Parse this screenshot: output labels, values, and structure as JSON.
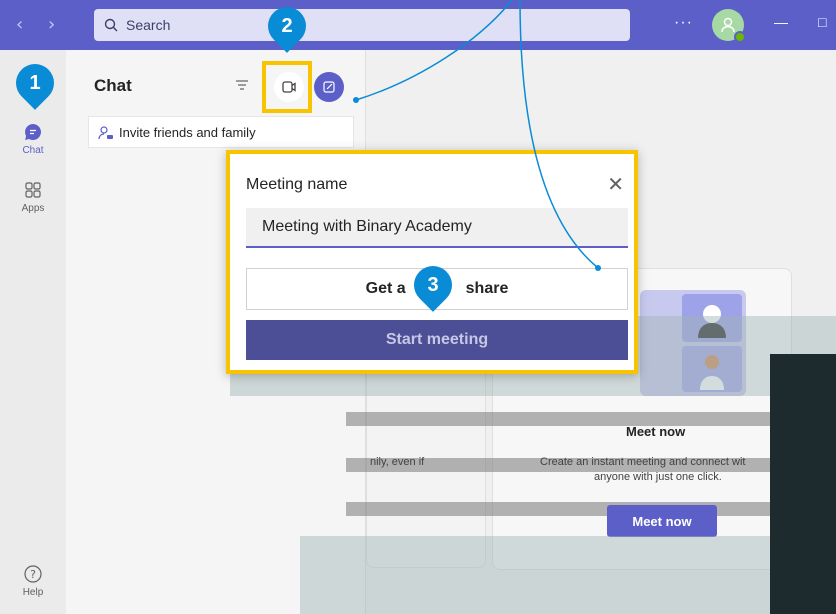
{
  "titlebar": {
    "search_placeholder": "Search",
    "more_label": "···",
    "minimize_label": "—",
    "maximize_label": "□"
  },
  "rail": {
    "items": [
      {
        "label": "Chat",
        "icon": "chat-icon"
      },
      {
        "label": "Apps",
        "icon": "apps-icon"
      },
      {
        "label": "Help",
        "icon": "help-icon"
      }
    ]
  },
  "chat_list": {
    "title": "Chat",
    "invite_label": "Invite friends and family"
  },
  "dialog": {
    "title": "Meeting name",
    "input_value": "Meeting with Binary Academy",
    "share_label_left": "Get a",
    "share_label_right": "share",
    "start_label": "Start meeting"
  },
  "callouts": {
    "one": "1",
    "two": "2",
    "three": "3"
  },
  "main": {
    "left_card_text": "nily, even if",
    "meet_now_title": "Meet now",
    "meet_now_desc_line1": "Create an instant meeting and connect wit",
    "meet_now_desc_line2": "anyone with just one click.",
    "meet_now_button": "Meet now"
  },
  "colors": {
    "brand": "#5b5fc7",
    "highlight": "#f8c400",
    "callout": "#0a8bd6"
  }
}
